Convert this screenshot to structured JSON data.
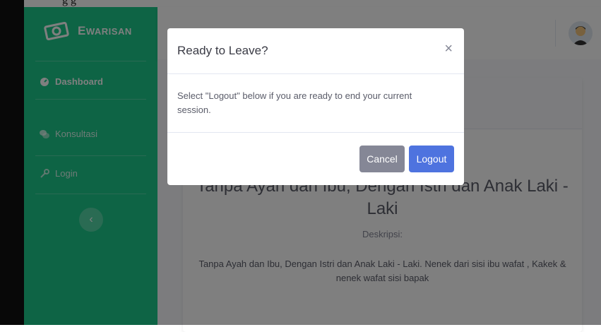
{
  "brand": {
    "prefix": "E",
    "name": "WARISAN"
  },
  "sidebar": {
    "items": [
      {
        "label": "Dashboard",
        "icon": "dashboard-icon",
        "active": true
      },
      {
        "label": "Konsultasi",
        "icon": "comments-icon",
        "active": false
      },
      {
        "label": "Login",
        "icon": "key-icon",
        "active": false
      }
    ],
    "toggle_glyph": "‹"
  },
  "card": {
    "title": "Tanpa Ayah dan Ibu, Dengan Istri dan Anak Laki - Laki",
    "desc_label": "Deskripsi:",
    "desc_text": "Tanpa Ayah dan Ibu, Dengan Istri dan Anak Laki - Laki. Nenek dari sisi ibu wafat , Kakek & nenek wafat sisi bapak"
  },
  "modal": {
    "title": "Ready to Leave?",
    "close_glyph": "×",
    "body": "Select \"Logout\" below if you are ready to end your current session.",
    "cancel_label": "Cancel",
    "logout_label": "Logout"
  },
  "colors": {
    "sidebar": "#1cc88a",
    "primary": "#4e73df",
    "secondary": "#858796"
  }
}
